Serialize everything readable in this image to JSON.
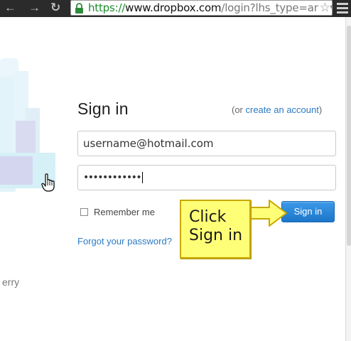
{
  "browser": {
    "url_protocol": "https://",
    "url_host": "www.dropbox.com",
    "url_path": "/login?lhs_type=anyw"
  },
  "login": {
    "title": "Sign in",
    "alt_prefix": "(or ",
    "create_account_link": "create an account",
    "alt_suffix": ")",
    "email_value": "username@hotmail.com",
    "password_mask": "••••••••••••",
    "remember_label": "Remember me",
    "forgot_link": "Forgot your password?",
    "signin_button": "Sign in"
  },
  "callout": {
    "line1": "Click",
    "line2": "Sign in"
  },
  "footer": {
    "partial_text": "erry"
  },
  "colors": {
    "link": "#2b7bc5",
    "button": "#2a87d8",
    "callout": "#ffff77"
  }
}
